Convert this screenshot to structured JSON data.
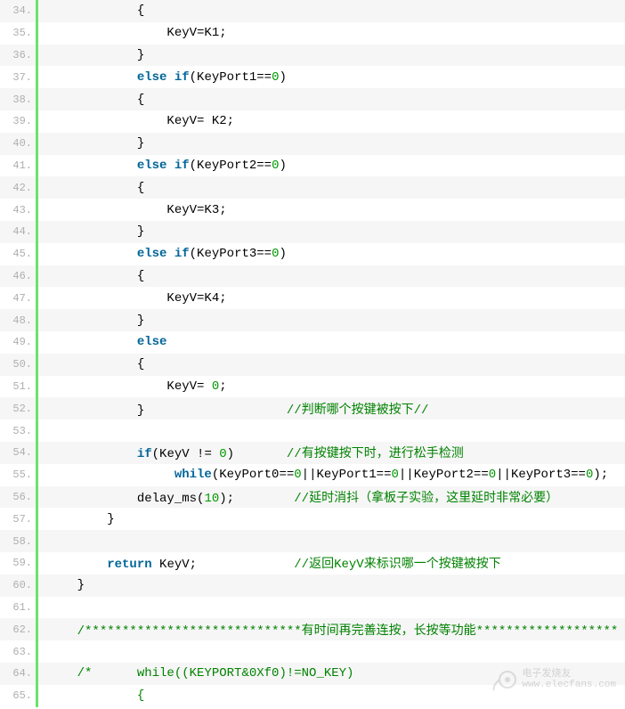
{
  "lines": [
    {
      "n": 34,
      "tokens": [
        {
          "t": "plain",
          "v": "            {"
        }
      ]
    },
    {
      "n": 35,
      "tokens": [
        {
          "t": "plain",
          "v": "                KeyV=K1;"
        }
      ]
    },
    {
      "n": 36,
      "tokens": [
        {
          "t": "plain",
          "v": "            }"
        }
      ]
    },
    {
      "n": 37,
      "tokens": [
        {
          "t": "plain",
          "v": "            "
        },
        {
          "t": "keyword",
          "v": "else"
        },
        {
          "t": "plain",
          "v": " "
        },
        {
          "t": "keyword",
          "v": "if"
        },
        {
          "t": "plain",
          "v": "(KeyPort1=="
        },
        {
          "t": "number",
          "v": "0"
        },
        {
          "t": "plain",
          "v": ")"
        }
      ]
    },
    {
      "n": 38,
      "tokens": [
        {
          "t": "plain",
          "v": "            {"
        }
      ]
    },
    {
      "n": 39,
      "tokens": [
        {
          "t": "plain",
          "v": "                KeyV= K2;"
        }
      ]
    },
    {
      "n": 40,
      "tokens": [
        {
          "t": "plain",
          "v": "            }"
        }
      ]
    },
    {
      "n": 41,
      "tokens": [
        {
          "t": "plain",
          "v": "            "
        },
        {
          "t": "keyword",
          "v": "else"
        },
        {
          "t": "plain",
          "v": " "
        },
        {
          "t": "keyword",
          "v": "if"
        },
        {
          "t": "plain",
          "v": "(KeyPort2=="
        },
        {
          "t": "number",
          "v": "0"
        },
        {
          "t": "plain",
          "v": ")"
        }
      ]
    },
    {
      "n": 42,
      "tokens": [
        {
          "t": "plain",
          "v": "            {"
        }
      ]
    },
    {
      "n": 43,
      "tokens": [
        {
          "t": "plain",
          "v": "                KeyV=K3;"
        }
      ]
    },
    {
      "n": 44,
      "tokens": [
        {
          "t": "plain",
          "v": "            }"
        }
      ]
    },
    {
      "n": 45,
      "tokens": [
        {
          "t": "plain",
          "v": "            "
        },
        {
          "t": "keyword",
          "v": "else"
        },
        {
          "t": "plain",
          "v": " "
        },
        {
          "t": "keyword",
          "v": "if"
        },
        {
          "t": "plain",
          "v": "(KeyPort3=="
        },
        {
          "t": "number",
          "v": "0"
        },
        {
          "t": "plain",
          "v": ")"
        }
      ]
    },
    {
      "n": 46,
      "tokens": [
        {
          "t": "plain",
          "v": "            {"
        }
      ]
    },
    {
      "n": 47,
      "tokens": [
        {
          "t": "plain",
          "v": "                KeyV=K4;"
        }
      ]
    },
    {
      "n": 48,
      "tokens": [
        {
          "t": "plain",
          "v": "            }"
        }
      ]
    },
    {
      "n": 49,
      "tokens": [
        {
          "t": "plain",
          "v": "            "
        },
        {
          "t": "keyword",
          "v": "else"
        }
      ]
    },
    {
      "n": 50,
      "tokens": [
        {
          "t": "plain",
          "v": "            {"
        }
      ]
    },
    {
      "n": 51,
      "tokens": [
        {
          "t": "plain",
          "v": "                KeyV= "
        },
        {
          "t": "number",
          "v": "0"
        },
        {
          "t": "plain",
          "v": ";"
        }
      ]
    },
    {
      "n": 52,
      "tokens": [
        {
          "t": "plain",
          "v": "            }                   "
        },
        {
          "t": "comment",
          "v": "//判断哪个按键被按下//"
        }
      ]
    },
    {
      "n": 53,
      "tokens": [
        {
          "t": "plain",
          "v": ""
        }
      ]
    },
    {
      "n": 54,
      "tokens": [
        {
          "t": "plain",
          "v": "            "
        },
        {
          "t": "keyword",
          "v": "if"
        },
        {
          "t": "plain",
          "v": "(KeyV != "
        },
        {
          "t": "number",
          "v": "0"
        },
        {
          "t": "plain",
          "v": ")       "
        },
        {
          "t": "comment",
          "v": "//有按键按下时，进行松手检测"
        }
      ]
    },
    {
      "n": 55,
      "tokens": [
        {
          "t": "plain",
          "v": "                 "
        },
        {
          "t": "keyword",
          "v": "while"
        },
        {
          "t": "plain",
          "v": "(KeyPort0=="
        },
        {
          "t": "number",
          "v": "0"
        },
        {
          "t": "plain",
          "v": "||KeyPort1=="
        },
        {
          "t": "number",
          "v": "0"
        },
        {
          "t": "plain",
          "v": "||KeyPort2=="
        },
        {
          "t": "number",
          "v": "0"
        },
        {
          "t": "plain",
          "v": "||KeyPort3=="
        },
        {
          "t": "number",
          "v": "0"
        },
        {
          "t": "plain",
          "v": ");"
        }
      ]
    },
    {
      "n": 56,
      "tokens": [
        {
          "t": "plain",
          "v": "            delay_ms("
        },
        {
          "t": "number",
          "v": "10"
        },
        {
          "t": "plain",
          "v": ");        "
        },
        {
          "t": "comment",
          "v": "//延时消抖（拿板子实验，这里延时非常必要）"
        }
      ]
    },
    {
      "n": 57,
      "tokens": [
        {
          "t": "plain",
          "v": "        }"
        }
      ]
    },
    {
      "n": 58,
      "tokens": [
        {
          "t": "plain",
          "v": ""
        }
      ]
    },
    {
      "n": 59,
      "tokens": [
        {
          "t": "plain",
          "v": "        "
        },
        {
          "t": "keyword",
          "v": "return"
        },
        {
          "t": "plain",
          "v": " KeyV;             "
        },
        {
          "t": "comment",
          "v": "//返回KeyV来标识哪一个按键被按下"
        }
      ]
    },
    {
      "n": 60,
      "tokens": [
        {
          "t": "plain",
          "v": "    }"
        }
      ]
    },
    {
      "n": 61,
      "tokens": [
        {
          "t": "plain",
          "v": ""
        }
      ]
    },
    {
      "n": 62,
      "tokens": [
        {
          "t": "plain",
          "v": "    "
        },
        {
          "t": "comment",
          "v": "/*****************************有时间再完善连按，长按等功能*******************"
        }
      ]
    },
    {
      "n": 63,
      "tokens": [
        {
          "t": "plain",
          "v": ""
        }
      ]
    },
    {
      "n": 64,
      "tokens": [
        {
          "t": "plain",
          "v": "    "
        },
        {
          "t": "comment",
          "v": "/*      while((KEYPORT&0Xf0)!=NO_KEY)"
        }
      ]
    },
    {
      "n": 65,
      "tokens": [
        {
          "t": "plain",
          "v": "            "
        },
        {
          "t": "comment",
          "v": "{"
        }
      ]
    }
  ],
  "watermark": {
    "line1": "电子发烧友",
    "line2": "www.elecfans.com"
  }
}
